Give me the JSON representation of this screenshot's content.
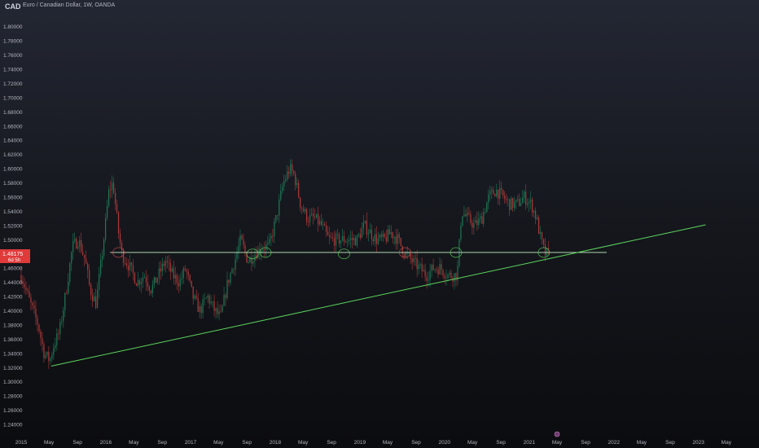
{
  "symbol": "CAD",
  "header_text": "Euro / Canadian Dollar, 1W, OANDA",
  "price_tag": {
    "value": "1.48175",
    "sub": "6d 5h"
  },
  "colors": {
    "background": "#131722",
    "up": "#26a69a",
    "up_dim": "#1f7a56",
    "down": "#b03a3a",
    "trendline": "#5cd65c",
    "axis_text": "#b2b5be",
    "tag": "#e03a3a",
    "marker": "#5cd65c",
    "marker_red": "#d05050"
  },
  "chart_data": {
    "type": "candlestick",
    "x_ticks": [
      "2015",
      "May",
      "Sep",
      "2016",
      "May",
      "Sep",
      "2017",
      "May",
      "Sep",
      "2018",
      "May",
      "Sep",
      "2019",
      "May",
      "Sep",
      "2020",
      "May",
      "Sep",
      "2021",
      "May",
      "Sep",
      "2022",
      "May",
      "Sep",
      "2023",
      "May"
    ],
    "y_ticks": [
      "1.80000",
      "1.78000",
      "1.76000",
      "1.74000",
      "1.72000",
      "1.70000",
      "1.68000",
      "1.66000",
      "1.64000",
      "1.62000",
      "1.60000",
      "1.58000",
      "1.56000",
      "1.54000",
      "1.52000",
      "1.50000",
      "1.46000",
      "1.44000",
      "1.42000",
      "1.40000",
      "1.38000",
      "1.36000",
      "1.34000",
      "1.32000",
      "1.30000",
      "1.28000",
      "1.26000",
      "1.24000"
    ],
    "ylim": [
      1.232,
      1.826
    ],
    "xlim": [
      "2015-01-01",
      "2023-08-01"
    ],
    "support_level": 1.482,
    "support_range": [
      "2016-01-20",
      "2021-12-01"
    ],
    "trendline": {
      "from": [
        "2015-05-10",
        1.322
      ],
      "to": [
        "2023-02-01",
        1.521
      ]
    },
    "circles": [
      [
        "2016-02-25",
        1.482
      ],
      [
        "2017-09-25",
        1.48
      ],
      [
        "2017-11-20",
        1.482
      ],
      [
        "2018-10-25",
        1.48
      ],
      [
        "2019-07-15",
        1.482
      ],
      [
        "2020-02-20",
        1.482
      ],
      [
        "2021-03-05",
        1.482
      ]
    ],
    "close_path": [
      [
        "2015-01-01",
        1.45
      ],
      [
        "2015-02-10",
        1.41
      ],
      [
        "2015-03-15",
        1.38
      ],
      [
        "2015-04-10",
        1.34
      ],
      [
        "2015-05-05",
        1.33
      ],
      [
        "2015-05-20",
        1.35
      ],
      [
        "2015-06-15",
        1.37
      ],
      [
        "2015-07-15",
        1.43
      ],
      [
        "2015-08-10",
        1.49
      ],
      [
        "2015-09-05",
        1.5
      ],
      [
        "2015-10-05",
        1.47
      ],
      [
        "2015-10-25",
        1.43
      ],
      [
        "2015-11-20",
        1.41
      ],
      [
        "2015-12-20",
        1.49
      ],
      [
        "2016-01-15",
        1.57
      ],
      [
        "2016-02-01",
        1.58
      ],
      [
        "2016-02-25",
        1.51
      ],
      [
        "2016-03-10",
        1.48
      ],
      [
        "2016-04-15",
        1.46
      ],
      [
        "2016-05-15",
        1.44
      ],
      [
        "2016-06-15",
        1.45
      ],
      [
        "2016-07-15",
        1.43
      ],
      [
        "2016-08-15",
        1.45
      ],
      [
        "2016-09-15",
        1.47
      ],
      [
        "2016-10-15",
        1.45
      ],
      [
        "2016-11-15",
        1.44
      ],
      [
        "2016-12-10",
        1.46
      ],
      [
        "2017-01-10",
        1.42
      ],
      [
        "2017-02-10",
        1.4
      ],
      [
        "2017-03-15",
        1.42
      ],
      [
        "2017-04-15",
        1.4
      ],
      [
        "2017-05-10",
        1.39
      ],
      [
        "2017-06-10",
        1.44
      ],
      [
        "2017-07-10",
        1.47
      ],
      [
        "2017-08-05",
        1.5
      ],
      [
        "2017-09-05",
        1.47
      ],
      [
        "2017-10-05",
        1.48
      ],
      [
        "2017-11-05",
        1.49
      ],
      [
        "2017-12-05",
        1.49
      ],
      [
        "2018-01-05",
        1.53
      ],
      [
        "2018-02-05",
        1.58
      ],
      [
        "2018-03-05",
        1.6
      ],
      [
        "2018-03-25",
        1.59
      ],
      [
        "2018-04-20",
        1.55
      ],
      [
        "2018-05-20",
        1.53
      ],
      [
        "2018-06-20",
        1.53
      ],
      [
        "2018-07-20",
        1.52
      ],
      [
        "2018-08-20",
        1.5
      ],
      [
        "2018-09-20",
        1.5
      ],
      [
        "2018-10-20",
        1.5
      ],
      [
        "2018-11-20",
        1.5
      ],
      [
        "2018-12-20",
        1.5
      ],
      [
        "2019-01-20",
        1.52
      ],
      [
        "2019-02-15",
        1.51
      ],
      [
        "2019-03-15",
        1.5
      ],
      [
        "2019-04-15",
        1.5
      ],
      [
        "2019-05-15",
        1.51
      ],
      [
        "2019-06-15",
        1.5
      ],
      [
        "2019-07-15",
        1.48
      ],
      [
        "2019-08-15",
        1.47
      ],
      [
        "2019-09-15",
        1.46
      ],
      [
        "2019-10-15",
        1.45
      ],
      [
        "2019-11-15",
        1.46
      ],
      [
        "2019-12-15",
        1.46
      ],
      [
        "2020-01-15",
        1.45
      ],
      [
        "2020-02-25",
        1.45
      ],
      [
        "2020-03-15",
        1.54
      ],
      [
        "2020-04-10",
        1.53
      ],
      [
        "2020-05-10",
        1.52
      ],
      [
        "2020-06-10",
        1.53
      ],
      [
        "2020-07-10",
        1.56
      ],
      [
        "2020-08-10",
        1.57
      ],
      [
        "2020-09-10",
        1.56
      ],
      [
        "2020-10-10",
        1.55
      ],
      [
        "2020-11-10",
        1.55
      ],
      [
        "2020-12-10",
        1.56
      ],
      [
        "2021-01-10",
        1.55
      ],
      [
        "2021-02-01",
        1.53
      ],
      [
        "2021-02-20",
        1.5
      ],
      [
        "2021-03-10",
        1.48
      ],
      [
        "2021-03-25",
        1.48
      ]
    ]
  }
}
